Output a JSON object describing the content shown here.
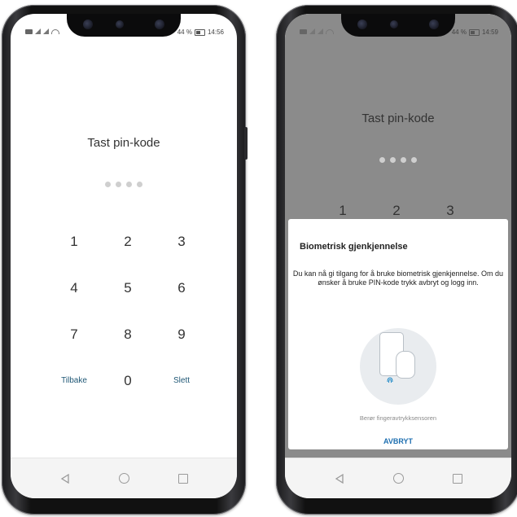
{
  "left_phone": {
    "status": {
      "battery_percent": "44 %",
      "time": "14:56"
    },
    "title": "Tast pin-kode",
    "pin_dots": 4,
    "keys": [
      {
        "label": "1",
        "small": false
      },
      {
        "label": "2",
        "small": false
      },
      {
        "label": "3",
        "small": false
      },
      {
        "label": "4",
        "small": false
      },
      {
        "label": "5",
        "small": false
      },
      {
        "label": "6",
        "small": false
      },
      {
        "label": "7",
        "small": false
      },
      {
        "label": "8",
        "small": false
      },
      {
        "label": "9",
        "small": false
      },
      {
        "label": "Tilbake",
        "small": true
      },
      {
        "label": "0",
        "small": false
      },
      {
        "label": "Slett",
        "small": true
      }
    ]
  },
  "right_phone": {
    "status": {
      "battery_percent": "44 %",
      "time": "14:59"
    },
    "title": "Tast pin-kode",
    "pin_dots": 4,
    "keys_visible": [
      "1",
      "2",
      "3"
    ],
    "dialog": {
      "title": "Biometrisk gjenkjennelse",
      "body": "Du kan nå gi tilgang for å bruke biometrisk gjenkjennelse. Om du ønsker å bruke PIN-kode trykk avbryt og logg inn.",
      "hint": "Berør fingeravtrykksensoren",
      "cancel_label": "AVBRYT"
    }
  },
  "icons": {
    "nav_back": "triangle-back-icon",
    "nav_home": "circle-home-icon",
    "nav_recent": "square-recent-icon",
    "fingerprint": "fingerprint-icon"
  },
  "colors": {
    "key_text": "#333333",
    "link_text": "#1f5775",
    "overlay": "#8b8b8b",
    "accent": "#1e6fb0"
  }
}
